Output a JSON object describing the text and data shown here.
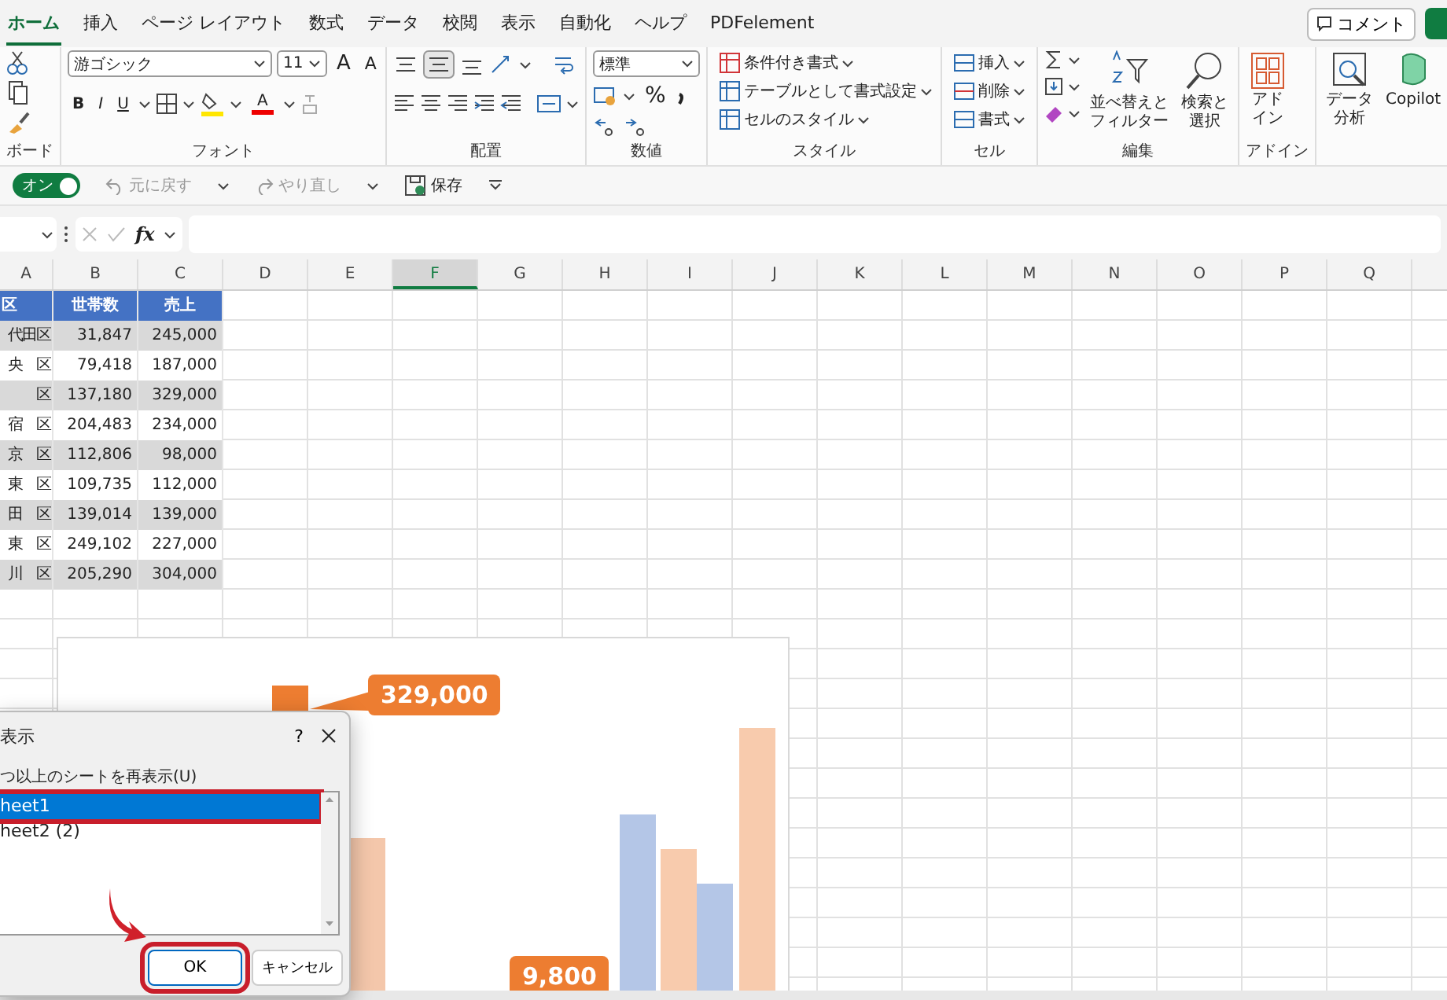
{
  "tabs": [
    {
      "label": "ホーム",
      "selected": true
    },
    {
      "label": "挿入",
      "selected": false
    },
    {
      "label": "ページ レイアウト",
      "selected": false
    },
    {
      "label": "数式",
      "selected": false
    },
    {
      "label": "データ",
      "selected": false
    },
    {
      "label": "校閲",
      "selected": false
    },
    {
      "label": "表示",
      "selected": false
    },
    {
      "label": "自動化",
      "selected": false
    },
    {
      "label": "ヘルプ",
      "selected": false
    },
    {
      "label": "PDFelement",
      "selected": false
    }
  ],
  "comment_button": "コメント",
  "ribbon": {
    "clipboard": {
      "label": "ボード"
    },
    "font": {
      "label": "フォント",
      "font_name": "游ゴシック",
      "font_size": "11",
      "grow": "A",
      "shrink": "A",
      "bold": "B",
      "italic": "I",
      "underline": "U",
      "color_letter": "A"
    },
    "alignment": {
      "label": "配置"
    },
    "number": {
      "label": "数値",
      "format": "標準",
      "percent": "%"
    },
    "styles": {
      "label": "スタイル",
      "items": [
        "条件付き書式",
        "テーブルとして書式設定",
        "セルのスタイル"
      ]
    },
    "cells": {
      "label": "セル",
      "items": [
        "挿入",
        "削除",
        "書式"
      ]
    },
    "editing": {
      "label": "編集",
      "sort": [
        "並べ替えと",
        "フィルター"
      ],
      "find": [
        "検索と",
        "選択"
      ]
    },
    "addins": {
      "label": "アドイン",
      "button": [
        "アド",
        "イン"
      ]
    },
    "extra": [
      [
        "データ",
        "分析"
      ],
      [
        "Copilot"
      ]
    ]
  },
  "quick_access": {
    "autosave_label": "オン",
    "autosave_on": true,
    "undo": "元に戻す",
    "redo": "やり直し",
    "save": "保存"
  },
  "formula_bar": {
    "fx": "fx"
  },
  "sheet": {
    "columns": [
      {
        "label": "A",
        "selected": false
      },
      {
        "label": "B",
        "selected": false
      },
      {
        "label": "C",
        "selected": false
      },
      {
        "label": "D",
        "selected": false
      },
      {
        "label": "E",
        "selected": false
      },
      {
        "label": "F",
        "selected": true
      },
      {
        "label": "G",
        "selected": false
      },
      {
        "label": "H",
        "selected": false
      },
      {
        "label": "I",
        "selected": false
      },
      {
        "label": "J",
        "selected": false
      },
      {
        "label": "K",
        "selected": false
      },
      {
        "label": "L",
        "selected": false
      },
      {
        "label": "M",
        "selected": false
      },
      {
        "label": "N",
        "selected": false
      },
      {
        "label": "O",
        "selected": false
      },
      {
        "label": "P",
        "selected": false
      },
      {
        "label": "Q",
        "selected": false
      }
    ],
    "table": {
      "headers": [
        "区",
        "世帯数",
        "売上"
      ],
      "rows": [
        [
          "代田区",
          "31,847",
          "245,000"
        ],
        [
          "央　区",
          "79,418",
          "187,000"
        ],
        [
          "区",
          "137,180",
          "329,000"
        ],
        [
          "宿　区",
          "204,483",
          "234,000"
        ],
        [
          "京　区",
          "112,806",
          "98,000"
        ],
        [
          "東　区",
          "109,735",
          "112,000"
        ],
        [
          "田　区",
          "139,014",
          "139,000"
        ],
        [
          "東　区",
          "249,102",
          "227,000"
        ],
        [
          "川　区",
          "205,290",
          "304,000"
        ]
      ]
    }
  },
  "chart": {
    "callouts": [
      "329,000",
      "9,800"
    ]
  },
  "dialog": {
    "title": "表示",
    "help": "?",
    "label": "つ以上のシートを再表示(U)",
    "items": [
      {
        "label": "heet1",
        "selected": true,
        "highlighted": true
      },
      {
        "label": "heet2 (2)",
        "selected": false,
        "highlighted": false
      }
    ],
    "buttons": [
      {
        "label": "OK",
        "kind": "primary",
        "highlighted": true
      },
      {
        "label": "キャンセル",
        "kind": "secondary",
        "highlighted": false
      }
    ]
  }
}
